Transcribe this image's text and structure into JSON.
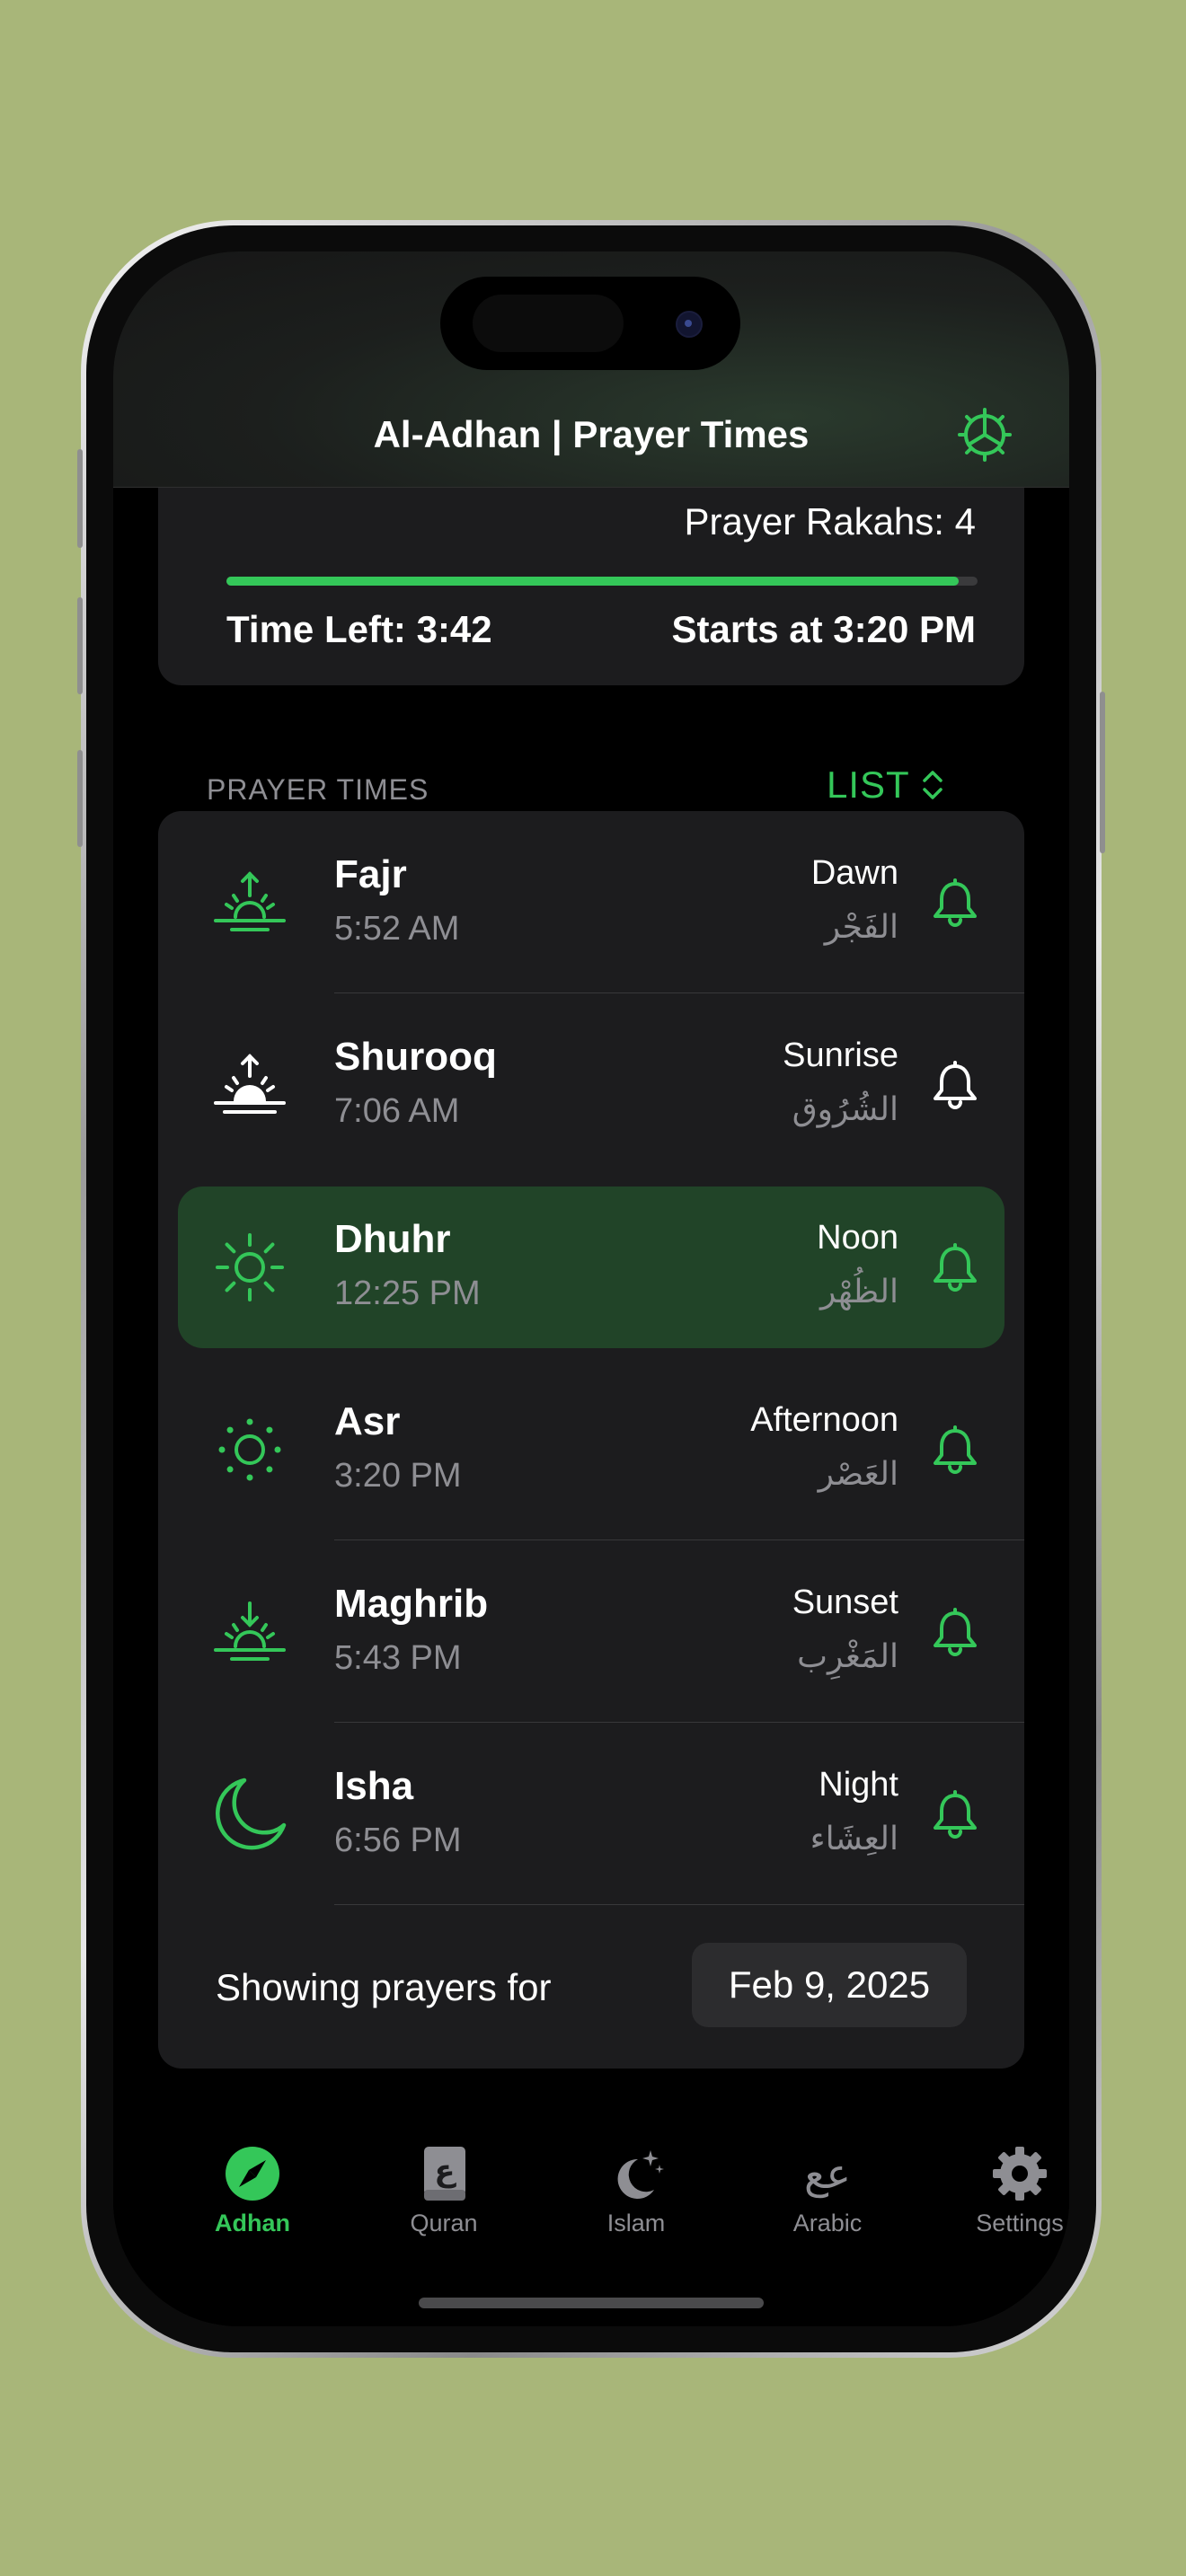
{
  "app": {
    "title": "Al-Adhan | Prayer Times"
  },
  "progress": {
    "rakahs_label": "Prayer Rakahs: 4",
    "fraction": 0.975,
    "time_left": "Time Left: 3:42",
    "starts_at": "Starts at 3:20 PM"
  },
  "section": {
    "label": "PRAYER TIMES",
    "view_mode": "LIST"
  },
  "prayers": [
    {
      "name": "Fajr",
      "time": "5:52 AM",
      "english": "Dawn",
      "arabic": "الفَجْر",
      "icon": "sunrise-up-icon",
      "color": "#34c759",
      "active": false
    },
    {
      "name": "Shurooq",
      "time": "7:06 AM",
      "english": "Sunrise",
      "arabic": "الشُرُوق",
      "icon": "sunrise-filled-icon",
      "color": "#ffffff",
      "active": false
    },
    {
      "name": "Dhuhr",
      "time": "12:25 PM",
      "english": "Noon",
      "arabic": "الظُهْر",
      "icon": "sun-icon",
      "color": "#34c759",
      "active": true
    },
    {
      "name": "Asr",
      "time": "3:20 PM",
      "english": "Afternoon",
      "arabic": "العَصْر",
      "icon": "sun-dotted-icon",
      "color": "#34c759",
      "active": false
    },
    {
      "name": "Maghrib",
      "time": "5:43 PM",
      "english": "Sunset",
      "arabic": "المَغْرِب",
      "icon": "sunset-down-icon",
      "color": "#34c759",
      "active": false
    },
    {
      "name": "Isha",
      "time": "6:56 PM",
      "english": "Night",
      "arabic": "العِشَاء",
      "icon": "moon-icon",
      "color": "#34c759",
      "active": false
    }
  ],
  "footer": {
    "showing_label": "Showing prayers for",
    "date": "Feb 9, 2025"
  },
  "tabs": [
    {
      "label": "Adhan",
      "icon": "compass-icon",
      "active": true
    },
    {
      "label": "Quran",
      "icon": "book-icon",
      "active": false
    },
    {
      "label": "Islam",
      "icon": "moon-stars-icon",
      "active": false
    },
    {
      "label": "Arabic",
      "icon": "arabic-letters-icon",
      "active": false
    },
    {
      "label": "Settings",
      "icon": "gear-icon",
      "active": false
    }
  ],
  "colors": {
    "accent": "#34c759",
    "background": "#a8b679",
    "card": "#1c1c1e",
    "highlight": "#214428"
  }
}
